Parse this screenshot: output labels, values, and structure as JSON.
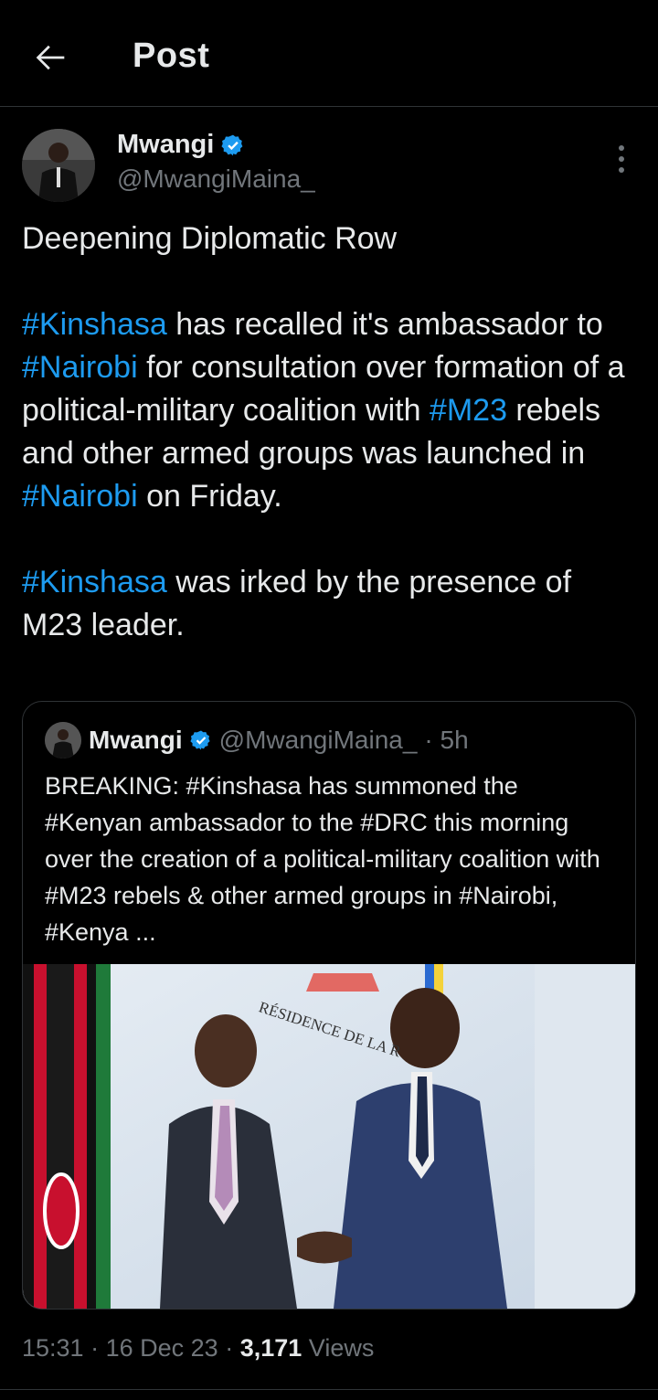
{
  "header": {
    "title": "Post"
  },
  "author": {
    "name": "Mwangi",
    "handle": "@MwangiMaina_"
  },
  "tweet": {
    "l1": "Deepening Diplomatic Row",
    "p2": [
      {
        "text": "#Kinshasa",
        "tag": true
      },
      {
        "text": " has recalled it's ambassador to ",
        "tag": false
      },
      {
        "text": "#Nairobi",
        "tag": true
      },
      {
        "text": " for consultation over formation of a political-military coalition with ",
        "tag": false
      },
      {
        "text": "#M23",
        "tag": true
      },
      {
        "text": " rebels and other armed groups was launched in ",
        "tag": false
      },
      {
        "text": "#Nairobi",
        "tag": true
      },
      {
        "text": " on Friday.",
        "tag": false
      }
    ],
    "p3": [
      {
        "text": "#Kinshasa",
        "tag": true
      },
      {
        "text": " was irked by the presence of M23 leader.",
        "tag": false
      }
    ]
  },
  "quote": {
    "name": "Mwangi",
    "handle": "@MwangiMaina_",
    "time": "· 5h",
    "text": "BREAKING: #Kinshasa has summoned the #Kenyan ambassador to the #DRC this morning over the creation of a political-military coalition with #M23 rebels & other armed groups in #Nairobi, #Kenya ...",
    "image_caption": "RÉSIDENCE DE LA R"
  },
  "meta": {
    "time": "15:31",
    "date": "16 Dec 23",
    "views_count": "3,171",
    "views_label": "Views"
  },
  "icons": [
    "arrow-left-icon",
    "verified-badge-icon",
    "more-vertical-icon"
  ],
  "colors": {
    "background": "#000000",
    "text": "#e7e9ea",
    "muted": "#71767b",
    "link": "#1d9bf0",
    "verified": "#1d9bf0",
    "border": "#2f3336"
  }
}
